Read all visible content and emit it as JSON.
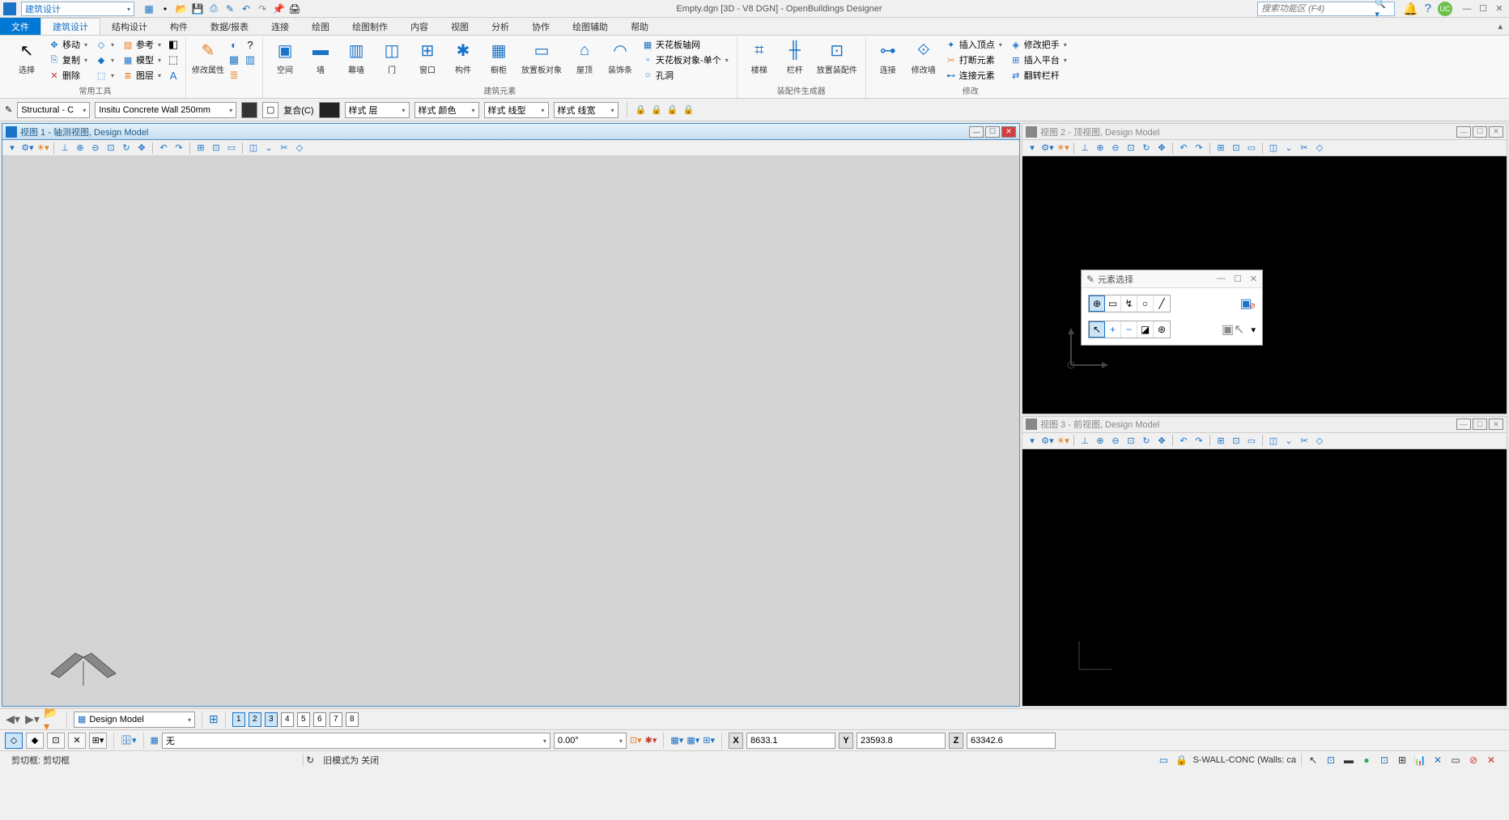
{
  "titlebar": {
    "workflow": "建筑设计",
    "title": "Empty.dgn [3D - V8 DGN] - OpenBuildings Designer",
    "search_placeholder": "搜索功能区 (F4)"
  },
  "ribbon_tabs": {
    "file": "文件",
    "items": [
      "建筑设计",
      "结构设计",
      "构件",
      "数据/报表",
      "连接",
      "绘图",
      "绘图制作",
      "内容",
      "视图",
      "分析",
      "协作",
      "绘图辅助",
      "帮助"
    ],
    "active": 0
  },
  "ribbon": {
    "group1": {
      "label": "常用工具",
      "select": "选择",
      "move": "移动",
      "copy": "复制",
      "delete": "删除",
      "ref": "参考",
      "model": "模型",
      "layer": "图层"
    },
    "group2": {
      "label": "",
      "modifyprop": "修改属性"
    },
    "group3": {
      "label": "建筑元素",
      "space": "空间",
      "wall": "墙",
      "curtain": "幕墙",
      "door": "门",
      "window": "窗口",
      "component": "构件",
      "cabinet": "橱柜",
      "placeboard": "放置板对象",
      "roof": "屋顶",
      "trim": "装饰条",
      "ceilinggrid": "天花板轴网",
      "ceilingsingle": "天花板对象-单个",
      "hole": "孔洞"
    },
    "group4": {
      "label": "装配件生成器",
      "stair": "楼梯",
      "railing": "栏杆",
      "placeassy": "放置装配件"
    },
    "group5": {
      "label": "修改",
      "connect": "连接",
      "modifywall": "修改墙",
      "insertvertex": "插入顶点",
      "breakelem": "打断元素",
      "connectelem": "连接元素",
      "modifyhandle": "修改把手",
      "insertplatform": "插入平台",
      "fliprailing": "翻转栏杆"
    }
  },
  "attrbar": {
    "family": "Structural - C",
    "part": "Insitu Concrete Wall 250mm",
    "composite": "复合(C)",
    "style_layer": "样式 层",
    "style_color": "样式 颜色",
    "style_linetype": "样式 线型",
    "style_lineweight": "样式 线宽"
  },
  "views": {
    "v1": {
      "title": "视图 1 - 轴测视图, Design Model"
    },
    "v2": {
      "title": "视图 2 - 顶视图, Design Model"
    },
    "v3": {
      "title": "视图 3 - 前视图, Design Model"
    }
  },
  "dialog": {
    "title": "元素选择"
  },
  "navbar": {
    "model": "Design Model",
    "nums": [
      "1",
      "2",
      "3",
      "4",
      "5",
      "6",
      "7",
      "8"
    ]
  },
  "toolbar2": {
    "none": "无",
    "angle": "0.00°",
    "x_label": "X",
    "x_val": "8633.1",
    "y_label": "Y",
    "y_val": "23593.8",
    "z_label": "Z",
    "z_val": "63342.6"
  },
  "statusbar": {
    "left": "剪切框: 剪切框",
    "mid": "旧模式为 关闭",
    "right": "S-WALL-CONC (Walls: ca"
  }
}
